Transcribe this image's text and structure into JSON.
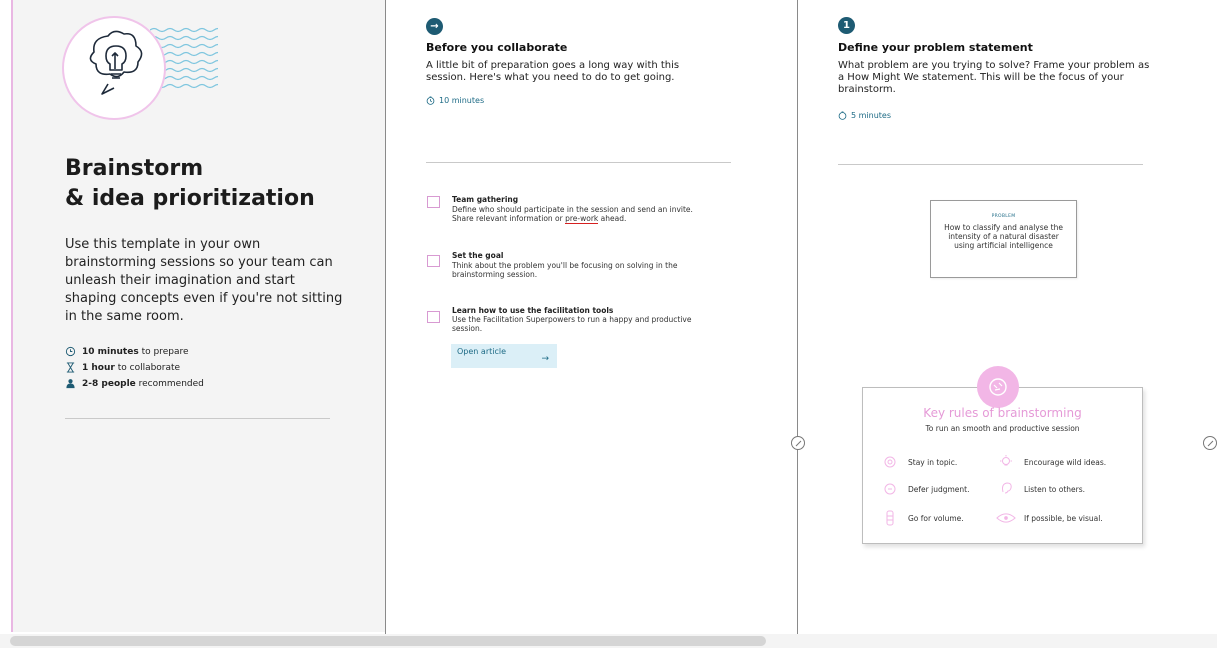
{
  "intro": {
    "title_line1": "Brainstorm",
    "title_line2": "& idea prioritization",
    "subtitle": "Use this template in your own brainstorming sessions so your team can unleash their imagination and start shaping concepts even if you're not sitting in the same room.",
    "meta": [
      {
        "bold": "10 minutes",
        "text": "to prepare",
        "icon": "clock-icon"
      },
      {
        "bold": "1 hour",
        "text": "to collaborate",
        "icon": "hourglass-icon"
      },
      {
        "bold": "2-8 people",
        "text": "recommended",
        "icon": "person-icon"
      }
    ]
  },
  "prep": {
    "badge": "→",
    "title": "Before you collaborate",
    "desc": "A little bit of preparation goes a long way with this session. Here's what you need to do to get going.",
    "time": "10 minutes",
    "items": [
      {
        "title": "Team gathering",
        "desc_before": "Define who should participate in the session and send an invite. Share relevant information or ",
        "link": "pre-work",
        "desc_after": " ahead.",
        "icon_label": "A"
      },
      {
        "title": "Set the goal",
        "desc": "Think about the problem you'll be focusing on solving in the brainstorming session.",
        "icon_label": "B"
      },
      {
        "title": "Learn how to use the facilitation tools",
        "desc": "Use the Facilitation Superpowers to run a happy and productive session.",
        "icon_label": "C"
      }
    ],
    "button": {
      "label": "Open article",
      "arrow": "→"
    }
  },
  "define": {
    "badge": "1",
    "title": "Define your problem statement",
    "desc": "What problem are you trying to solve? Frame your problem as a How Might We statement. This will be the focus of your brainstorm.",
    "time": "5 minutes",
    "card": {
      "label": "PROBLEM",
      "text": "How to classify and analyse the intensity of a natural disaster using artificial intelligence"
    }
  },
  "rules": {
    "title": "Key rules of brainstorming",
    "subtitle": "To run an smooth and productive session",
    "items": [
      {
        "text": "Stay in topic.",
        "icon": "target-icon"
      },
      {
        "text": "Encourage wild ideas.",
        "icon": "lightbulb-icon"
      },
      {
        "text": "Defer judgment.",
        "icon": "speech-icon"
      },
      {
        "text": "Listen to others.",
        "icon": "ear-icon"
      },
      {
        "text": "Go for volume.",
        "icon": "stack-icon"
      },
      {
        "text": "If possible, be visual.",
        "icon": "eye-icon"
      }
    ]
  },
  "colors": {
    "accent_teal": "#1e5b73",
    "pink": "#e59ad7",
    "link_blue_bg": "#dbeff7"
  }
}
